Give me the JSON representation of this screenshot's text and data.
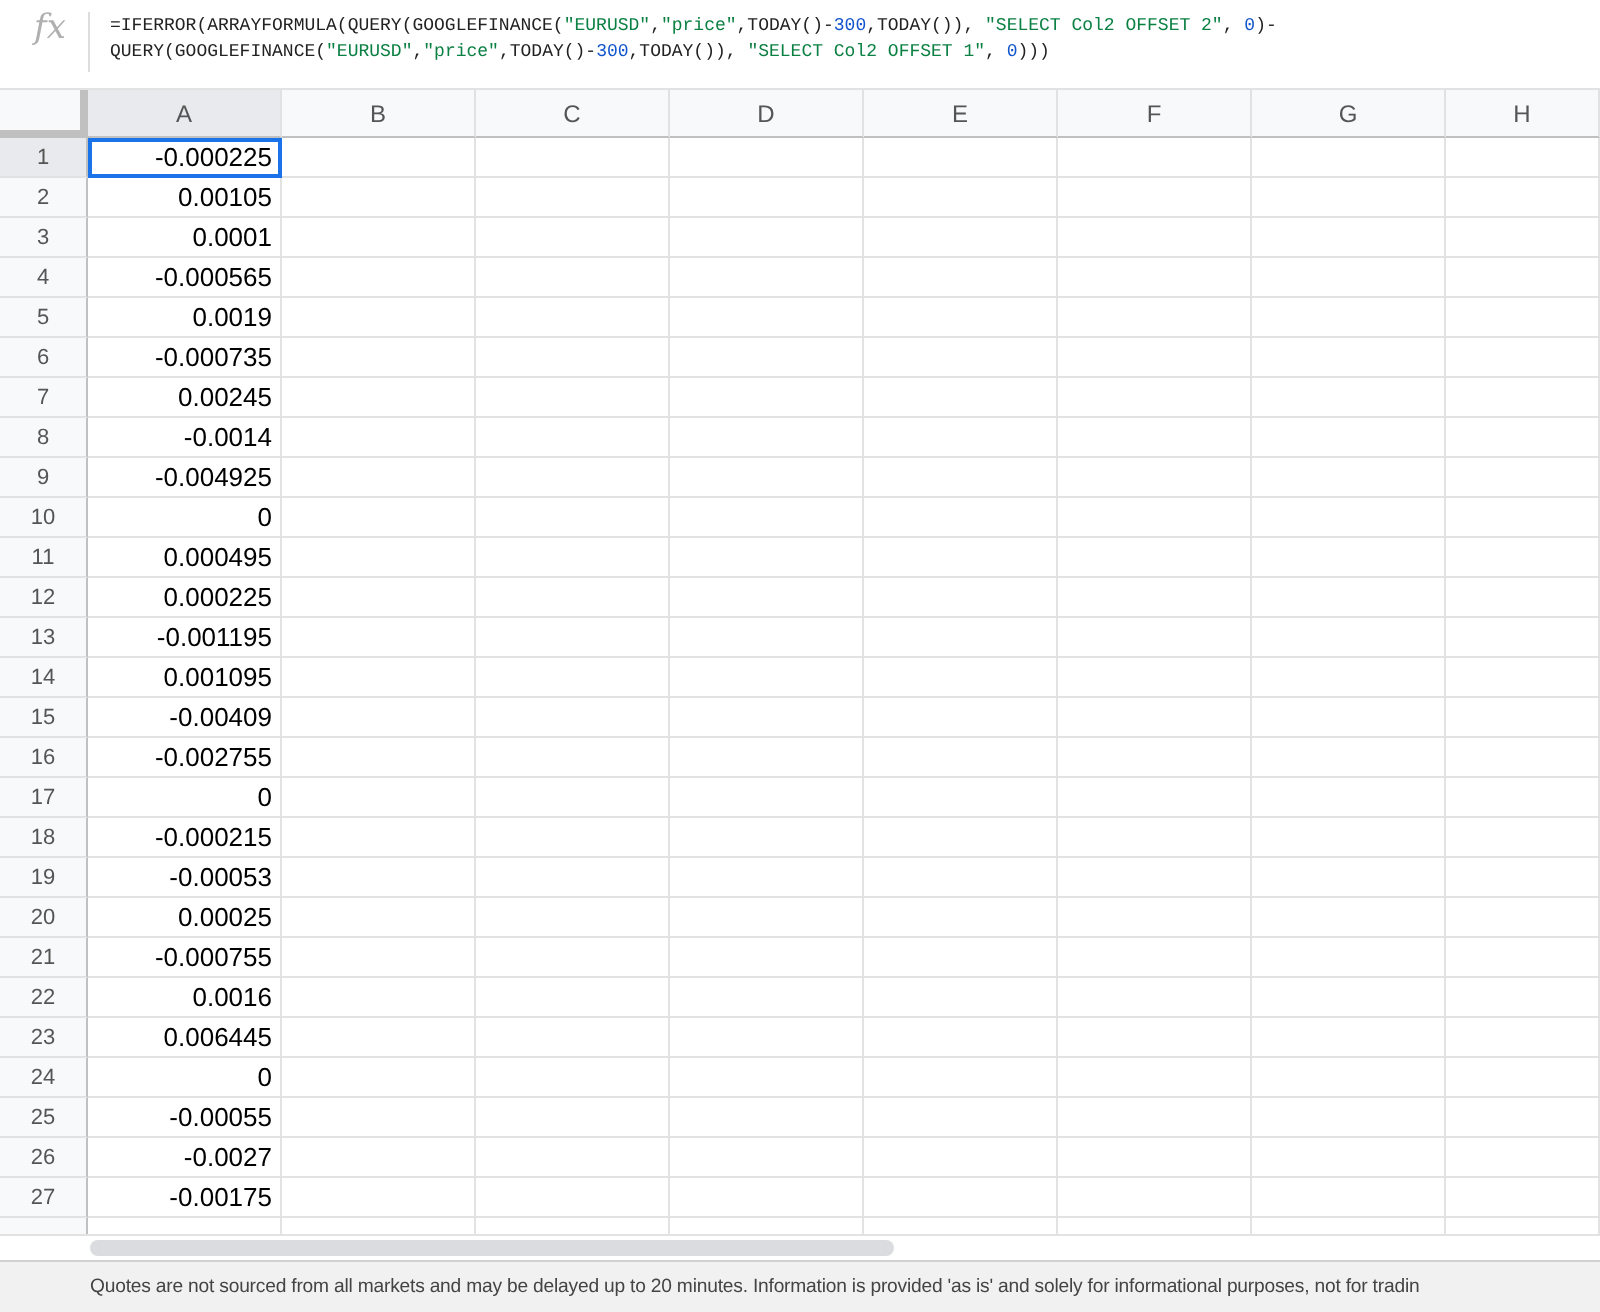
{
  "formula_bar": {
    "icon": "fx",
    "lines": [
      [
        {
          "kind": "plain",
          "text": "=IFERROR(ARRAYFORMULA(QUERY(GOOGLEFINANCE("
        },
        {
          "kind": "string",
          "text": "\"EURUSD\""
        },
        {
          "kind": "plain",
          "text": ","
        },
        {
          "kind": "string",
          "text": "\"price\""
        },
        {
          "kind": "plain",
          "text": ",TODAY()-"
        },
        {
          "kind": "number",
          "text": "300"
        },
        {
          "kind": "plain",
          "text": ",TODAY()), "
        },
        {
          "kind": "string",
          "text": "\"SELECT Col2 OFFSET 2\""
        },
        {
          "kind": "plain",
          "text": ", "
        },
        {
          "kind": "number",
          "text": "0"
        },
        {
          "kind": "plain",
          "text": ")-"
        }
      ],
      [
        {
          "kind": "plain",
          "text": "QUERY(GOOGLEFINANCE("
        },
        {
          "kind": "string",
          "text": "\"EURUSD\""
        },
        {
          "kind": "plain",
          "text": ","
        },
        {
          "kind": "string",
          "text": "\"price\""
        },
        {
          "kind": "plain",
          "text": ",TODAY()-"
        },
        {
          "kind": "number",
          "text": "300"
        },
        {
          "kind": "plain",
          "text": ",TODAY()), "
        },
        {
          "kind": "string",
          "text": "\"SELECT Col2 OFFSET 1\""
        },
        {
          "kind": "plain",
          "text": ", "
        },
        {
          "kind": "number",
          "text": "0"
        },
        {
          "kind": "plain",
          "text": ")))"
        }
      ]
    ]
  },
  "columns": [
    "A",
    "B",
    "C",
    "D",
    "E",
    "F",
    "G",
    "H"
  ],
  "rows": [
    {
      "number": "1",
      "value": "-0.000225",
      "selected": true
    },
    {
      "number": "2",
      "value": "0.00105",
      "selected": false
    },
    {
      "number": "3",
      "value": "0.0001",
      "selected": false
    },
    {
      "number": "4",
      "value": "-0.000565",
      "selected": false
    },
    {
      "number": "5",
      "value": "0.0019",
      "selected": false
    },
    {
      "number": "6",
      "value": "-0.000735",
      "selected": false
    },
    {
      "number": "7",
      "value": "0.00245",
      "selected": false
    },
    {
      "number": "8",
      "value": "-0.0014",
      "selected": false
    },
    {
      "number": "9",
      "value": "-0.004925",
      "selected": false
    },
    {
      "number": "10",
      "value": "0",
      "selected": false
    },
    {
      "number": "11",
      "value": "0.000495",
      "selected": false
    },
    {
      "number": "12",
      "value": "0.000225",
      "selected": false
    },
    {
      "number": "13",
      "value": "-0.001195",
      "selected": false
    },
    {
      "number": "14",
      "value": "0.001095",
      "selected": false
    },
    {
      "number": "15",
      "value": "-0.00409",
      "selected": false
    },
    {
      "number": "16",
      "value": "-0.002755",
      "selected": false
    },
    {
      "number": "17",
      "value": "0",
      "selected": false
    },
    {
      "number": "18",
      "value": "-0.000215",
      "selected": false
    },
    {
      "number": "19",
      "value": "-0.00053",
      "selected": false
    },
    {
      "number": "20",
      "value": "0.00025",
      "selected": false
    },
    {
      "number": "21",
      "value": "-0.000755",
      "selected": false
    },
    {
      "number": "22",
      "value": "0.0016",
      "selected": false
    },
    {
      "number": "23",
      "value": "0.006445",
      "selected": false
    },
    {
      "number": "24",
      "value": "0",
      "selected": false
    },
    {
      "number": "25",
      "value": "-0.00055",
      "selected": false
    },
    {
      "number": "26",
      "value": "-0.0027",
      "selected": false
    },
    {
      "number": "27",
      "value": "-0.00175",
      "selected": false
    }
  ],
  "footer": "Quotes are not sourced from all markets and may be delayed up to 20 minutes. Information is provided 'as is' and solely for informational purposes, not for tradin"
}
